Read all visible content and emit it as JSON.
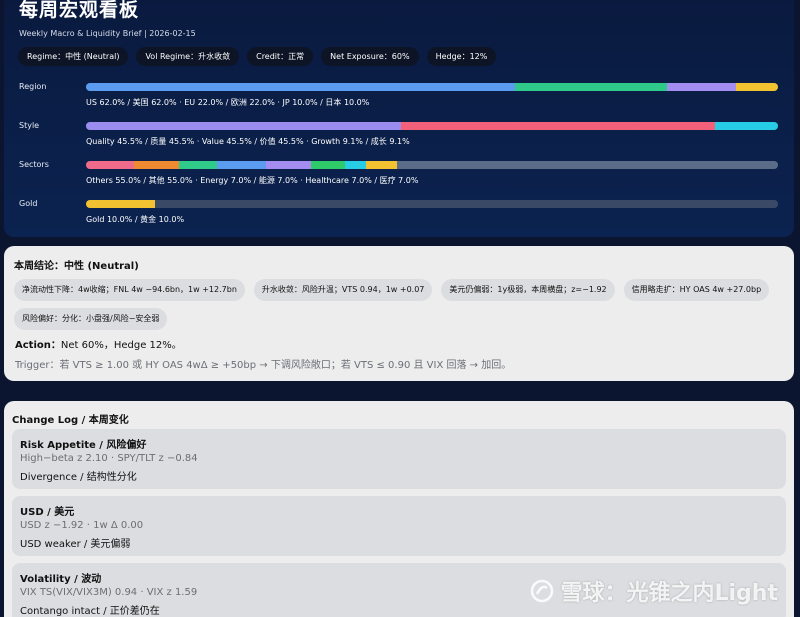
{
  "header": {
    "title": "每周宏观看板",
    "subtitle": "Weekly Macro & Liquidity Brief | 2026-02-15"
  },
  "chips": [
    "Regime：中性 (Neutral)",
    "Vol Regime：升水收敛",
    "Credit：正常",
    "Net Exposure：60%",
    "Hedge：12%"
  ],
  "allocation": {
    "region": {
      "label": "Region",
      "text": "US 62.0% / 美国 62.0% · EU 22.0% / 欧洲 22.0% · JP 10.0% / 日本 10.0%",
      "segments": [
        {
          "value": 62.0,
          "color": "#5b9cf0"
        },
        {
          "value": 22.0,
          "color": "#2fca8a"
        },
        {
          "value": 10.0,
          "color": "#a58cf0"
        },
        {
          "value": 6.0,
          "color": "#f2c230"
        }
      ]
    },
    "style": {
      "label": "Style",
      "text": "Quality 45.5% / 质量 45.5% · Value 45.5% / 价值 45.5% · Growth 9.1% / 成长 9.1%",
      "segments": [
        {
          "value": 45.5,
          "color": "#9b8cf0"
        },
        {
          "value": 45.5,
          "color": "#f2607a"
        },
        {
          "value": 9.1,
          "color": "#27cde4"
        }
      ]
    },
    "sectors": {
      "label": "Sectors",
      "text": "Others 55.0% / 其他 55.0% · Energy 7.0% / 能源 7.0% · Healthcare 7.0% / 医疗 7.0%",
      "segments": [
        {
          "value": 7.0,
          "color": "#f06a8a"
        },
        {
          "value": 6.5,
          "color": "#f08a30"
        },
        {
          "value": 5.5,
          "color": "#2fca8a"
        },
        {
          "value": 7.0,
          "color": "#5b9cf0"
        },
        {
          "value": 6.5,
          "color": "#a58cf0"
        },
        {
          "value": 5.0,
          "color": "#2fca6a"
        },
        {
          "value": 3.0,
          "color": "#27cde4"
        },
        {
          "value": 4.5,
          "color": "#f2c230"
        },
        {
          "value": 55.0,
          "color": "#5a6c88"
        }
      ]
    },
    "gold": {
      "label": "Gold",
      "text": "Gold 10.0% / 黄金 10.0%",
      "segments": [
        {
          "value": 10.0,
          "color": "#f2c230"
        },
        {
          "value": 90.0,
          "color": "#3a4a66"
        }
      ]
    }
  },
  "conclusion": {
    "title": "本周结论：中性 (Neutral)",
    "tags": [
      "净流动性下降：4w收缩；FNL 4w −94.6bn，1w +12.7bn",
      "升水收敛：风险升温；VTS 0.94，1w +0.07",
      "美元仍偏弱：1y极弱，本周横盘；z=−1.92",
      "信用略走扩：HY OAS 4w +27.0bp",
      "风险偏好：分化：小盘强/风险−安全弱"
    ],
    "action_label": "Action：",
    "action_text": "Net 60%，Hedge 12%。",
    "trigger": "Trigger：若 VTS ≥ 1.00 或 HY OAS 4wΔ ≥ +50bp → 下调风险敞口；若 VTS ≤ 0.90 且 VIX 回落 → 加回。"
  },
  "changelog": {
    "title": "Change Log / 本周变化",
    "items": [
      {
        "head": "Risk Appetite / 风险偏好",
        "line1": "High−beta z 2.10 · SPY/TLT z −0.84",
        "line2": "Divergence / 结构性分化"
      },
      {
        "head": "USD / 美元",
        "line1": "USD z −1.92 · 1w Δ 0.00",
        "line2": "USD weaker / 美元偏弱"
      },
      {
        "head": "Volatility / 波动",
        "line1": "VIX TS(VIX/VIX3M) 0.94 · VIX z 1.59",
        "line2": "Contango intact / 正价差仍在"
      }
    ]
  },
  "watermark": {
    "text": "雪球：光锥之内Light",
    "icon": "snowball-logo-icon"
  }
}
